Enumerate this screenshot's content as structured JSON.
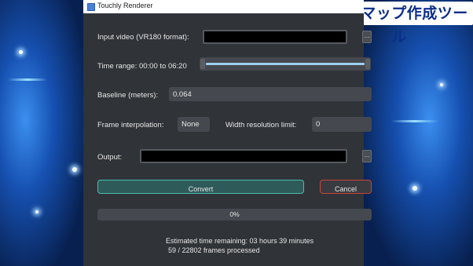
{
  "badge": {
    "text": "深度マップ作成ツール"
  },
  "window": {
    "title": "Touchly Renderer",
    "app_icon": "app-window-icon"
  },
  "form": {
    "input_video_label": "Input video (VR180 format):",
    "input_video_value": "",
    "browse_label": "...",
    "time_range_label": "Time range: 00:00 to 06:20",
    "time_range_start_fraction": 0.0,
    "time_range_end_fraction": 1.0,
    "baseline_label": "Baseline (meters):",
    "baseline_value": "0.064",
    "frame_interp_label": "Frame interpolation:",
    "frame_interp_value": "None",
    "width_limit_label": "Width resolution limit:",
    "width_limit_value": "0",
    "output_label": "Output:",
    "output_value": "",
    "output_browse_label": "..."
  },
  "actions": {
    "convert_label": "Convert",
    "cancel_label": "Cancel"
  },
  "progress": {
    "percent_text": "0%",
    "value": 0
  },
  "status": {
    "remaining": "Estimated time remaining: 03 hours 39 minutes",
    "frames": "59 / 22802 frames processed"
  },
  "colors": {
    "window_bg": "#303338",
    "convert_border": "#4cbcb0",
    "cancel_border": "#c8443a",
    "slider_fill": "#9ccff0"
  }
}
